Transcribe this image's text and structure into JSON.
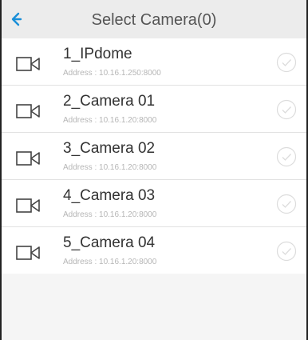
{
  "header": {
    "back_icon": "back-arrow-icon",
    "title": "Select Camera(0)"
  },
  "colors": {
    "accent": "#1a8fd8",
    "header_bg": "#ececec",
    "title_text": "#555555",
    "address_text": "#b6b6b6"
  },
  "cameras": [
    {
      "name": "1_IPdome",
      "address": "Address :  10.16.1.250:8000",
      "selected": false
    },
    {
      "name": "2_Camera 01",
      "address": "Address :  10.16.1.20:8000",
      "selected": false
    },
    {
      "name": "3_Camera 02",
      "address": "Address :  10.16.1.20:8000",
      "selected": false
    },
    {
      "name": "4_Camera 03",
      "address": "Address :  10.16.1.20:8000",
      "selected": false
    },
    {
      "name": "5_Camera 04",
      "address": "Address :  10.16.1.20:8000",
      "selected": false
    }
  ]
}
